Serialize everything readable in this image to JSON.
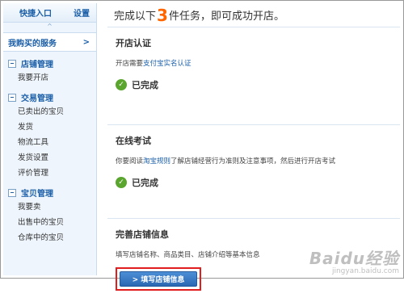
{
  "sidebar": {
    "quick_entry": "快捷入口",
    "settings": "设置",
    "collapse_caret": "^",
    "my_services": "我购买的服务",
    "my_services_arrow": ">",
    "sections": [
      {
        "title": "店铺管理",
        "items": [
          "我要开店"
        ]
      },
      {
        "title": "交易管理",
        "items": [
          "已卖出的宝贝",
          "发货",
          "物流工具",
          "发货设置",
          "评价管理"
        ]
      },
      {
        "title": "宝贝管理",
        "items": [
          "我要卖",
          "出售中的宝贝",
          "仓库中的宝贝"
        ]
      }
    ]
  },
  "main": {
    "title_prefix": "完成以下",
    "title_count": "3",
    "title_suffix": "件任务，即可成功开店。",
    "tasks": [
      {
        "title": "开店认证",
        "desc_prefix": "开店需要",
        "desc_link": "支付宝实名认证",
        "desc_suffix": "",
        "status": "已完成"
      },
      {
        "title": "在线考试",
        "desc_prefix": "你要阅读",
        "desc_link": "淘宝规则",
        "desc_suffix": "了解店铺经营行为准则及注意事项，然后进行开店考试",
        "status": "已完成"
      },
      {
        "title": "完善店铺信息",
        "desc": "填写店铺名称、商品类目、店铺介绍等基本信息",
        "button": "> 填写店铺信息"
      }
    ]
  },
  "watermark": {
    "logo": "Baidu经验",
    "url": "jingyan.baidu.com"
  },
  "colors": {
    "accent": "#1a5ea8",
    "count": "#ff6600",
    "done": "#5aa52e",
    "highlight": "#e21d1d"
  }
}
